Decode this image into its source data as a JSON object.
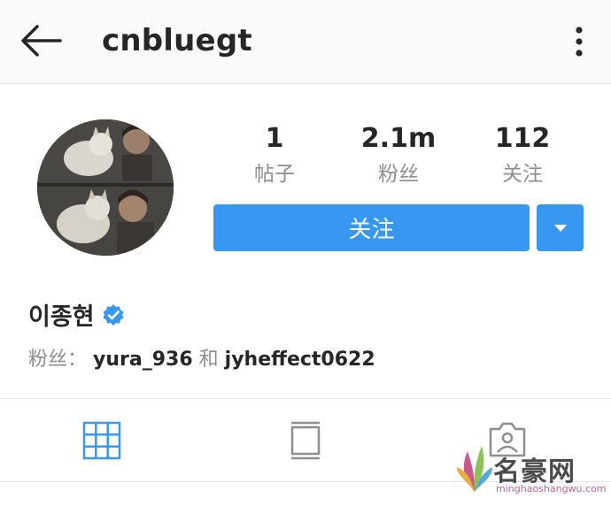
{
  "header": {
    "back_icon": "arrow-left-icon",
    "username": "cnbluegt",
    "more_icon": "vertical-dots-icon"
  },
  "profile": {
    "avatar_icon": "profile-photo",
    "stats": [
      {
        "value": "1",
        "label": "帖子"
      },
      {
        "value": "2.1m",
        "label": "粉丝"
      },
      {
        "value": "112",
        "label": "关注"
      }
    ],
    "follow_label": "关注",
    "dropdown_icon": "caret-down-icon",
    "display_name": "이종현",
    "verified_icon": "verified-badge-icon",
    "followed_by": {
      "prefix": "粉丝：",
      "account1": "yura_936",
      "connector": "和",
      "account2": "jyheffect0622"
    }
  },
  "tabs": [
    {
      "icon": "grid-icon",
      "active": true
    },
    {
      "icon": "feed-icon",
      "active": false
    },
    {
      "icon": "tagged-photos-icon",
      "active": false
    }
  ],
  "watermark": {
    "text": "名豪网",
    "url": "minghaoshangwu.com"
  },
  "colors": {
    "accent": "#3897f0",
    "text": "#262626",
    "muted": "#8e8e8e",
    "border": "#e3e3e3"
  }
}
